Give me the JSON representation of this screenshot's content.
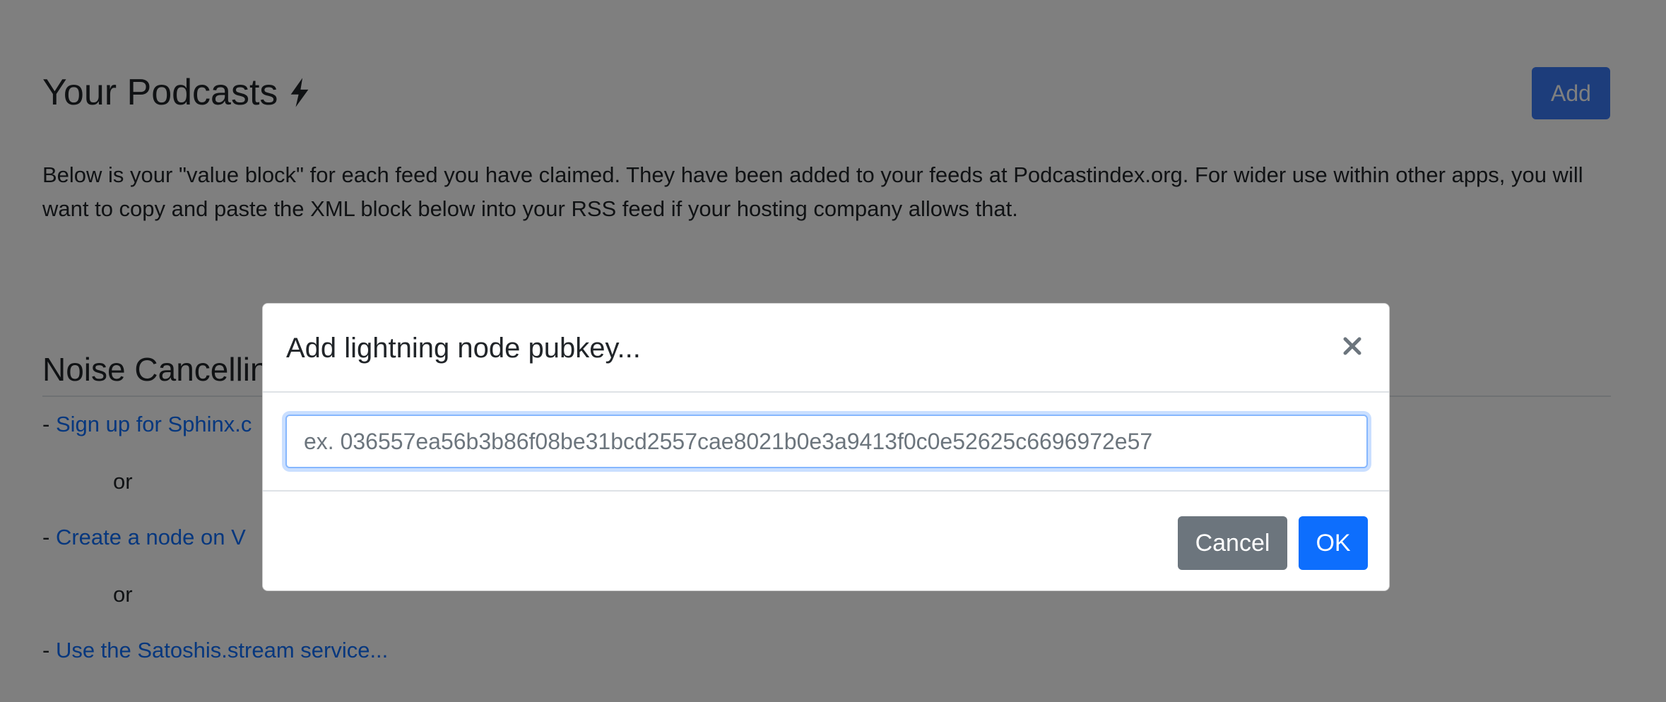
{
  "page": {
    "title": "Your Podcasts",
    "title_icon": "lightning-bolt-icon",
    "add_label": "Add",
    "intro": "Below is your \"value block\" for each feed you have claimed. They have been added to your feeds at Podcastindex.org. For wider use within other apps, you will want to copy and paste the XML block below into your RSS feed if your hosting company allows that.",
    "section_title": "Noise Cancellin",
    "options": [
      {
        "prefix": "- ",
        "link": "Sign up for Sphinx.c"
      },
      {
        "prefix": "- ",
        "link": "Create a node on V"
      },
      {
        "prefix": "- ",
        "link": "Use the Satoshis.stream service..."
      }
    ],
    "or_text": "or"
  },
  "modal": {
    "title": "Add lightning node pubkey...",
    "close_icon": "close-icon",
    "input_placeholder": "ex. 036557ea56b3b86f08be31bcd2557cae8021b0e3a9413f0c0e52625c6696972e57",
    "input_value": "",
    "cancel_label": "Cancel",
    "ok_label": "OK"
  },
  "colors": {
    "primary": "#0d6efd",
    "secondary": "#6c757d",
    "backdrop": "rgba(0,0,0,0.5)"
  }
}
